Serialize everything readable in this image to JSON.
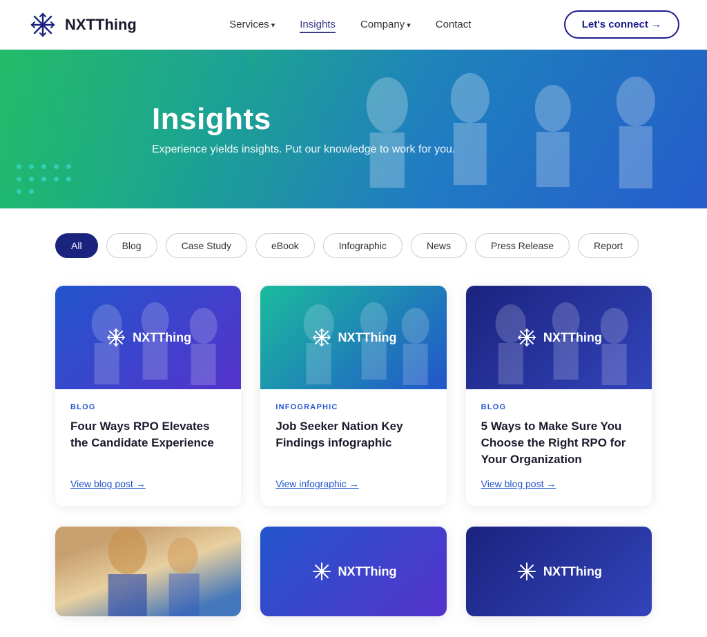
{
  "brand": {
    "name": "NXTThing",
    "logo_alt": "NXTThing logo"
  },
  "navbar": {
    "links": [
      {
        "label": "Services",
        "id": "services",
        "active": false,
        "has_dropdown": true
      },
      {
        "label": "Insights",
        "id": "insights",
        "active": true,
        "has_dropdown": false
      },
      {
        "label": "Company",
        "id": "company",
        "active": false,
        "has_dropdown": true
      },
      {
        "label": "Contact",
        "id": "contact",
        "active": false,
        "has_dropdown": false
      }
    ],
    "cta_label": "Let's connect →"
  },
  "hero": {
    "title": "Insights",
    "subtitle": "Experience yields insights. Put our knowledge to work for you."
  },
  "filters": {
    "buttons": [
      {
        "label": "All",
        "active": true
      },
      {
        "label": "Blog",
        "active": false
      },
      {
        "label": "Case Study",
        "active": false
      },
      {
        "label": "eBook",
        "active": false
      },
      {
        "label": "Infographic",
        "active": false
      },
      {
        "label": "News",
        "active": false
      },
      {
        "label": "Press Release",
        "active": false
      },
      {
        "label": "Report",
        "active": false
      }
    ]
  },
  "cards": [
    {
      "id": "card-1",
      "image_style": "blue-purple",
      "tag": "BLOG",
      "title": "Four Ways RPO Elevates the Candidate Experience",
      "link_label": "View blog post →"
    },
    {
      "id": "card-2",
      "image_style": "teal-blue",
      "tag": "INFOGRAPHIC",
      "title": "Job Seeker Nation Key Findings infographic",
      "link_label": "View infographic →"
    },
    {
      "id": "card-3",
      "image_style": "dark-blue",
      "tag": "BLOG",
      "title": "5 Ways to Make Sure You Choose the Right RPO for Your Organization",
      "link_label": "View blog post →"
    }
  ],
  "cards_bottom": [
    {
      "id": "card-4",
      "image_style": "photo",
      "tag": "",
      "title": "",
      "link_label": ""
    },
    {
      "id": "card-5",
      "image_style": "blue-purple",
      "tag": "",
      "title": "",
      "link_label": ""
    },
    {
      "id": "card-6",
      "image_style": "dark-blue",
      "tag": "",
      "title": "",
      "link_label": ""
    }
  ]
}
